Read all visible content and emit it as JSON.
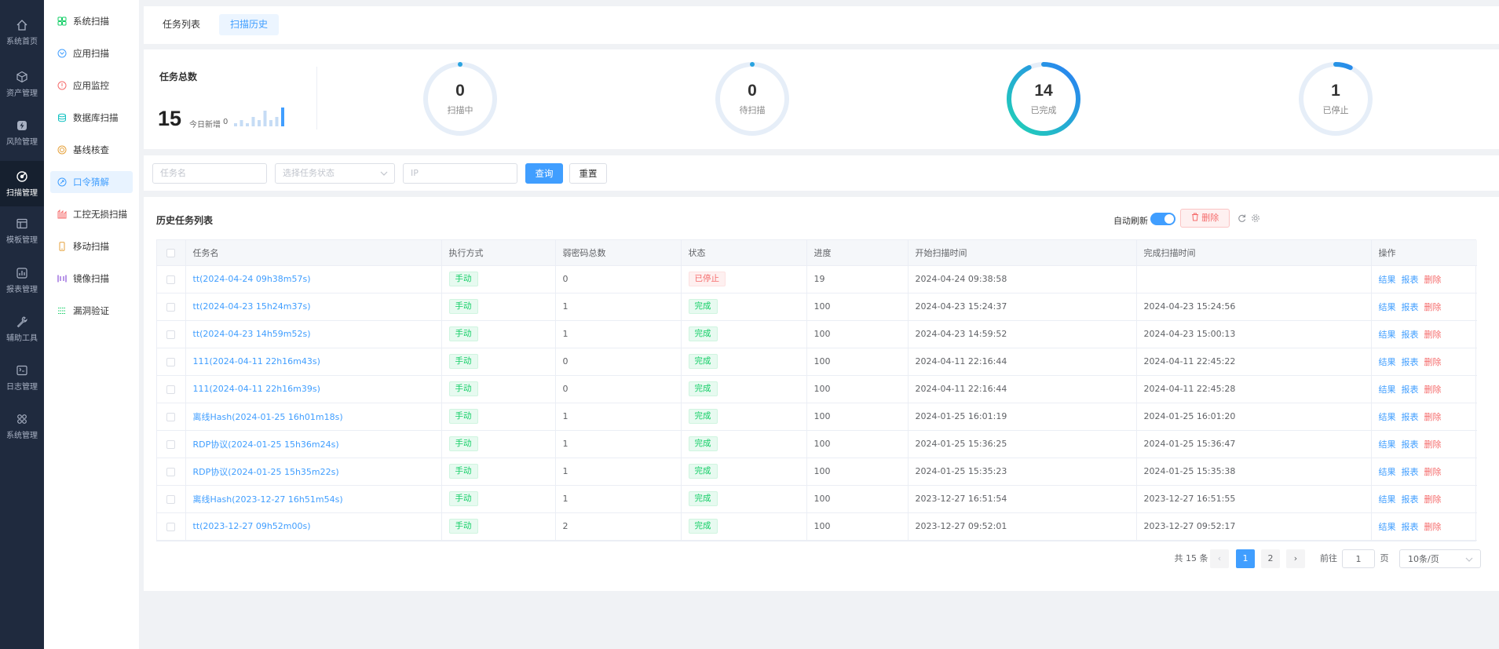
{
  "left_nav": [
    {
      "label": "系统首页",
      "icon": "home-icon",
      "active": false
    },
    {
      "label": "资产管理",
      "icon": "asset-icon",
      "active": false
    },
    {
      "label": "风险管理",
      "icon": "lightning-icon",
      "active": false
    },
    {
      "label": "扫描管理",
      "icon": "scan-icon",
      "active": true
    },
    {
      "label": "模板管理",
      "icon": "template-icon",
      "active": false
    },
    {
      "label": "报表管理",
      "icon": "chart-icon",
      "active": false
    },
    {
      "label": "辅助工具",
      "icon": "wrench-icon",
      "active": false
    },
    {
      "label": "日志管理",
      "icon": "log-icon",
      "active": false
    },
    {
      "label": "系统管理",
      "icon": "settings-grid-icon",
      "active": false
    }
  ],
  "sub_nav": [
    {
      "label": "系统扫描",
      "icon": "system-scan-icon",
      "color": "#13ce66",
      "active": false
    },
    {
      "label": "应用扫描",
      "icon": "app-scan-icon",
      "color": "#409eff",
      "active": false
    },
    {
      "label": "应用监控",
      "icon": "monitor-icon",
      "color": "#f56c6c",
      "active": false
    },
    {
      "label": "数据库扫描",
      "icon": "database-icon",
      "color": "#13c2c2",
      "active": false
    },
    {
      "label": "基线核查",
      "icon": "baseline-icon",
      "color": "#e6a23c",
      "active": false
    },
    {
      "label": "口令猜解",
      "icon": "password-icon",
      "color": "#409eff",
      "active": true
    },
    {
      "label": "工控无损扫描",
      "icon": "industrial-icon",
      "color": "#f56c6c",
      "active": false
    },
    {
      "label": "移动扫描",
      "icon": "mobile-icon",
      "color": "#e6a23c",
      "active": false
    },
    {
      "label": "镜像扫描",
      "icon": "mirror-icon",
      "color": "#722ed1",
      "active": false
    },
    {
      "label": "漏洞验证",
      "icon": "verify-icon",
      "color": "#13ce66",
      "active": false
    }
  ],
  "tabs": [
    {
      "label": "任务列表",
      "active": false
    },
    {
      "label": "扫描历史",
      "active": true
    }
  ],
  "summary": {
    "title": "任务总数",
    "total": "15",
    "today_label": "今日新增",
    "today_value": "0",
    "sparkline": [
      1,
      2,
      1,
      3,
      2,
      5,
      2,
      3,
      6
    ],
    "gauges": [
      {
        "value": "0",
        "label": "扫描中",
        "fraction": 0.0
      },
      {
        "value": "0",
        "label": "待扫描",
        "fraction": 0.0
      },
      {
        "value": "14",
        "label": "已完成",
        "fraction": 0.93
      },
      {
        "value": "1",
        "label": "已停止",
        "fraction": 0.07
      }
    ]
  },
  "filters": {
    "task_name_placeholder": "任务名",
    "status_placeholder": "选择任务状态",
    "ip_placeholder": "IP",
    "query_label": "查询",
    "reset_label": "重置"
  },
  "list": {
    "title": "历史任务列表",
    "auto_refresh_label": "自动刷新",
    "auto_refresh_on": true,
    "delete_label": "删除",
    "columns": [
      "任务名",
      "执行方式",
      "弱密码总数",
      "状态",
      "进度",
      "开始扫描时间",
      "完成扫描时间",
      "操作"
    ],
    "op_labels": {
      "result": "结果",
      "report": "报表",
      "delete": "删除"
    },
    "rows": [
      {
        "name": "tt(2024-04-24 09h38m57s)",
        "mode": "手动",
        "weak": "0",
        "status": "已停止",
        "status_type": "red",
        "progress": "19",
        "start": "2024-04-24 09:38:58",
        "end": ""
      },
      {
        "name": "tt(2024-04-23 15h24m37s)",
        "mode": "手动",
        "weak": "1",
        "status": "完成",
        "status_type": "green",
        "progress": "100",
        "start": "2024-04-23 15:24:37",
        "end": "2024-04-23 15:24:56"
      },
      {
        "name": "tt(2024-04-23 14h59m52s)",
        "mode": "手动",
        "weak": "1",
        "status": "完成",
        "status_type": "green",
        "progress": "100",
        "start": "2024-04-23 14:59:52",
        "end": "2024-04-23 15:00:13"
      },
      {
        "name": "111(2024-04-11 22h16m43s)",
        "mode": "手动",
        "weak": "0",
        "status": "完成",
        "status_type": "green",
        "progress": "100",
        "start": "2024-04-11 22:16:44",
        "end": "2024-04-11 22:45:22"
      },
      {
        "name": "111(2024-04-11 22h16m39s)",
        "mode": "手动",
        "weak": "0",
        "status": "完成",
        "status_type": "green",
        "progress": "100",
        "start": "2024-04-11 22:16:44",
        "end": "2024-04-11 22:45:28"
      },
      {
        "name": "离线Hash(2024-01-25 16h01m18s)",
        "mode": "手动",
        "weak": "1",
        "status": "完成",
        "status_type": "green",
        "progress": "100",
        "start": "2024-01-25 16:01:19",
        "end": "2024-01-25 16:01:20"
      },
      {
        "name": "RDP协议(2024-01-25 15h36m24s)",
        "mode": "手动",
        "weak": "1",
        "status": "完成",
        "status_type": "green",
        "progress": "100",
        "start": "2024-01-25 15:36:25",
        "end": "2024-01-25 15:36:47"
      },
      {
        "name": "RDP协议(2024-01-25 15h35m22s)",
        "mode": "手动",
        "weak": "1",
        "status": "完成",
        "status_type": "green",
        "progress": "100",
        "start": "2024-01-25 15:35:23",
        "end": "2024-01-25 15:35:38"
      },
      {
        "name": "离线Hash(2023-12-27 16h51m54s)",
        "mode": "手动",
        "weak": "1",
        "status": "完成",
        "status_type": "green",
        "progress": "100",
        "start": "2023-12-27 16:51:54",
        "end": "2023-12-27 16:51:55"
      },
      {
        "name": "tt(2023-12-27 09h52m00s)",
        "mode": "手动",
        "weak": "2",
        "status": "完成",
        "status_type": "green",
        "progress": "100",
        "start": "2023-12-27 09:52:01",
        "end": "2023-12-27 09:52:17"
      }
    ]
  },
  "pagination": {
    "total_text": "共 15 条",
    "prev": "‹",
    "pages": [
      "1",
      "2"
    ],
    "current": "1",
    "next": "›",
    "goto_label": "前往",
    "goto_value": "1",
    "page_unit": "页",
    "page_size": "10条/页"
  },
  "colors": {
    "accent": "#409eff",
    "sidebar": "#1f2a3e",
    "danger": "#f56c6c",
    "success": "#13ce66"
  }
}
